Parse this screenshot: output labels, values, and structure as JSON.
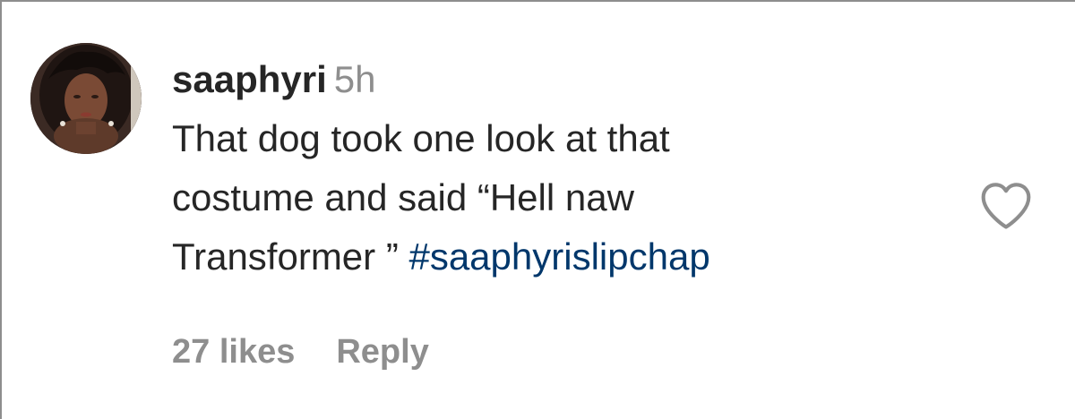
{
  "comment": {
    "username": "saaphyri",
    "timestamp": "5h",
    "text_line_1": "That dog took one look at that",
    "text_line_2": "costume and said “Hell naw",
    "text_line_3": "Transformer ” ",
    "hashtag": "#saaphyrislipchap",
    "likes": "27 likes",
    "reply_label": "Reply",
    "like_icon": "heart-outline-icon",
    "avatar": "user-avatar"
  },
  "colors": {
    "text": "#262626",
    "muted": "#8e8e8e",
    "hashtag": "#00376b"
  }
}
